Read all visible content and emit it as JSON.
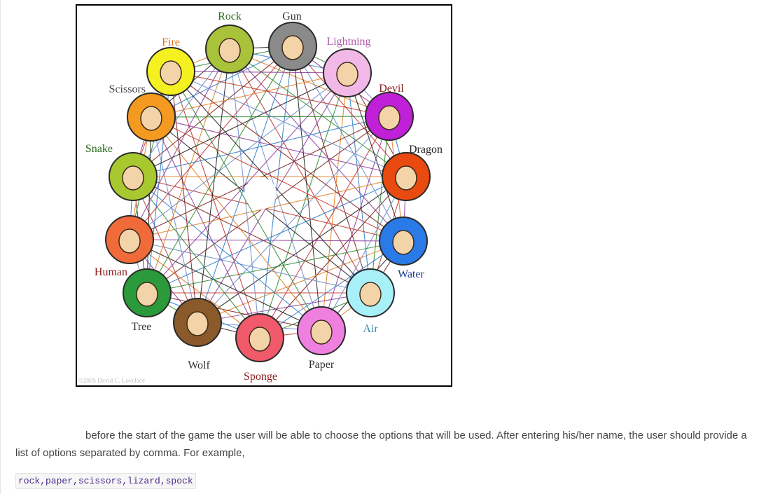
{
  "figure": {
    "nodes": [
      {
        "label": "Rock",
        "fill": "#a8c23a",
        "label_color": "#2d6a1a"
      },
      {
        "label": "Gun",
        "fill": "#8a8a8a",
        "label_color": "#333333"
      },
      {
        "label": "Lightning",
        "fill": "#f2b8e8",
        "label_color": "#b05aa8"
      },
      {
        "label": "Devil",
        "fill": "#c020d8",
        "label_color": "#8a1a1a"
      },
      {
        "label": "Dragon",
        "fill": "#e84a10",
        "label_color": "#222222"
      },
      {
        "label": "Water",
        "fill": "#2a7ae8",
        "label_color": "#1a3a8a"
      },
      {
        "label": "Air",
        "fill": "#a8f0f8",
        "label_color": "#3a8ab0"
      },
      {
        "label": "Paper",
        "fill": "#f080e0",
        "label_color": "#333333"
      },
      {
        "label": "Sponge",
        "fill": "#f05a6a",
        "label_color": "#8a1a1a"
      },
      {
        "label": "Wolf",
        "fill": "#8a5a2a",
        "label_color": "#333333"
      },
      {
        "label": "Tree",
        "fill": "#2a9a3a",
        "label_color": "#333333"
      },
      {
        "label": "Human",
        "fill": "#f06a3a",
        "label_color": "#8a1a1a"
      },
      {
        "label": "Snake",
        "fill": "#a8c830",
        "label_color": "#2a6a1a"
      },
      {
        "label": "Scissors",
        "fill": "#f59a20",
        "label_color": "#444444"
      },
      {
        "label": "Fire",
        "fill": "#f5f020",
        "label_color": "#e0701a"
      }
    ],
    "watermark": "©2005 David C. Lovelace"
  },
  "text": {
    "paragraph": "before the start of the game the user will be able to choose the options that will be used. After entering his/her name, the user should provide a list of options separated by comma. For example,",
    "code_example": "rock,paper,scissors,lizard,spock"
  }
}
